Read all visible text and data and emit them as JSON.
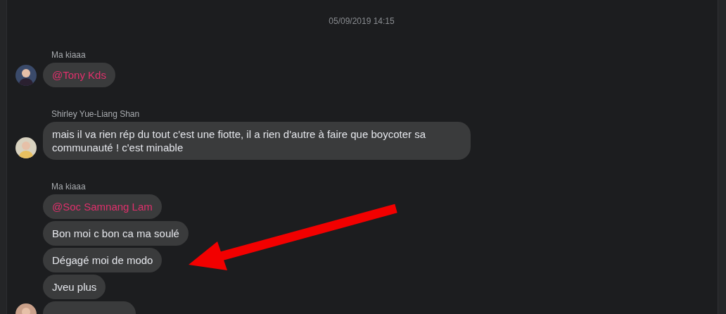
{
  "timestamp": "05/09/2019 14:15",
  "groups": [
    {
      "sender": "Ma kiaaa",
      "messages": [
        {
          "kind": "mention",
          "text": "@Tony Kds"
        }
      ]
    },
    {
      "sender": "Shirley Yue-Liang Shan",
      "messages": [
        {
          "kind": "text",
          "text": "mais il va rien rép du tout c'est une fiotte, il a rien d'autre à faire que boycoter sa communauté ! c'est minable"
        }
      ]
    },
    {
      "sender": "Ma kiaaa",
      "messages": [
        {
          "kind": "mention",
          "text": "@Soc Samnang Lam"
        },
        {
          "kind": "text",
          "text": "Bon moi c bon ca ma soulé"
        },
        {
          "kind": "text",
          "text": "Dégagé moi de modo"
        },
        {
          "kind": "text",
          "text": "Jveu plus"
        },
        {
          "kind": "cut_off"
        }
      ]
    }
  ]
}
